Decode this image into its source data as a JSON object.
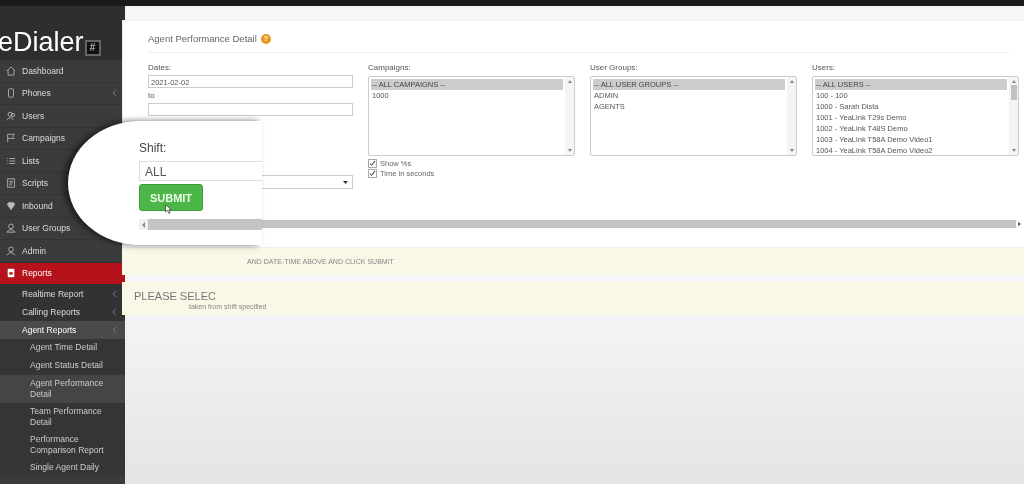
{
  "sidebar": {
    "logo": "eDialer",
    "logo_badge": "#",
    "items": [
      {
        "label": "Dashboard",
        "has_submenu": false,
        "selected": false
      },
      {
        "label": "Phones",
        "has_submenu": true,
        "selected": false
      },
      {
        "label": "Users",
        "has_submenu": false,
        "selected": false
      },
      {
        "label": "Campaigns",
        "has_submenu": false,
        "selected": false
      },
      {
        "label": "Lists",
        "has_submenu": false,
        "selected": false
      },
      {
        "label": "Scripts",
        "has_submenu": false,
        "selected": false
      },
      {
        "label": "Inbound",
        "has_submenu": false,
        "selected": false
      },
      {
        "label": "User Groups",
        "has_submenu": false,
        "selected": false
      },
      {
        "label": "Admin",
        "has_submenu": false,
        "selected": false
      },
      {
        "label": "Reports",
        "has_submenu": false,
        "selected": true
      }
    ],
    "subitems": [
      {
        "label": "Realtime Report",
        "has_submenu": true,
        "expanded": false
      },
      {
        "label": "Calling Reports",
        "has_submenu": true,
        "expanded": false
      },
      {
        "label": "Agent Reports",
        "has_submenu": true,
        "expanded": true,
        "children": [
          {
            "label": "Agent Time Detail",
            "selected": false
          },
          {
            "label": "Agent Status Detail",
            "selected": false
          },
          {
            "label": "Agent Performance Detail",
            "selected": true
          },
          {
            "label": "Team Performance Detail",
            "selected": false
          },
          {
            "label": "Performance Comparison Report",
            "selected": false
          },
          {
            "label": "Single Agent Daily",
            "selected": false
          }
        ]
      }
    ]
  },
  "panel": {
    "title": "Agent Performance Detail",
    "help_icon": "?",
    "dates": {
      "label": "Dates:",
      "from": "2021-02-02",
      "to_label": "to"
    },
    "campaigns": {
      "label": "Campaigns:",
      "options": [
        {
          "label": "-- ALL CAMPAIGNS --",
          "selected": true
        },
        {
          "label": "1000",
          "selected": false
        }
      ]
    },
    "checkboxes": [
      {
        "label": "Show %s",
        "checked": true
      },
      {
        "label": "Time in seconds",
        "checked": true
      }
    ],
    "user_groups": {
      "label": "User Groups:",
      "options": [
        {
          "label": "-- ALL USER GROUPS --",
          "selected": true
        },
        {
          "label": "ADMIN",
          "selected": false
        },
        {
          "label": "AGENTS",
          "selected": false
        }
      ]
    },
    "users": {
      "label": "Users:",
      "options": [
        {
          "label": "-- ALL USERS --",
          "selected": true
        },
        {
          "label": "100 - 100",
          "selected": false
        },
        {
          "label": "1000 - Sarah Dista",
          "selected": false
        },
        {
          "label": "1001 - YeaLink T29s Demo",
          "selected": false
        },
        {
          "label": "1002 - YeaLink T48S Demo",
          "selected": false
        },
        {
          "label": "1003 - YeaLink T58A Demo Video1",
          "selected": false
        },
        {
          "label": "1004 - YeaLink T58A Demo Video2",
          "selected": false
        }
      ]
    }
  },
  "magnifier": {
    "shift_label": "Shift:",
    "shift_value": "ALL",
    "submit": "SUBMIT"
  },
  "banners": [
    {
      "texts": [
        "AND DATE-TIME ABOVE AND CLICK SUBMIT"
      ]
    },
    {
      "texts": [
        "PLEASE SELEC",
        "taken from shift specified"
      ]
    }
  ]
}
